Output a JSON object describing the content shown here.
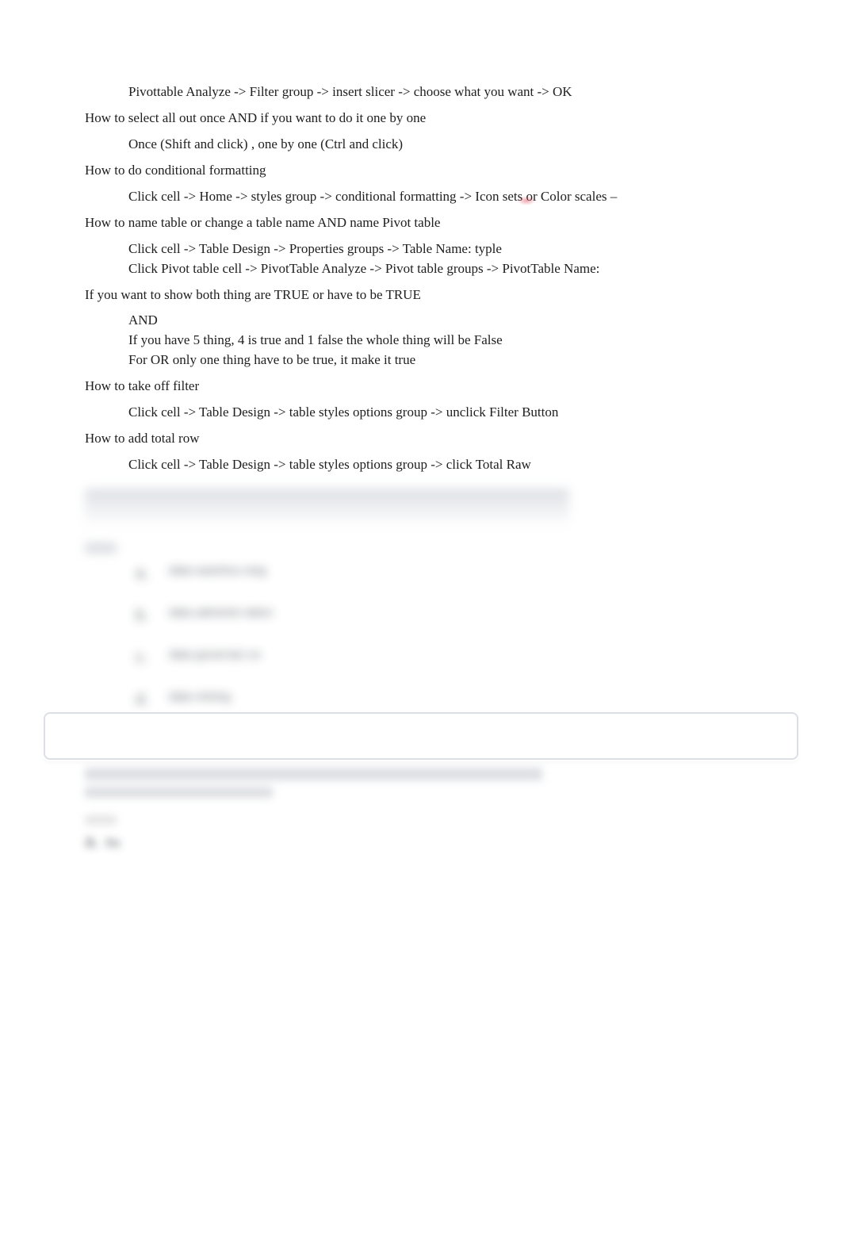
{
  "bullet_glyph": "",
  "sections": [
    {
      "heading": null,
      "items": [
        "Pivottable Analyze -> Filter group -> insert slicer -> choose what you want -> OK"
      ]
    },
    {
      "heading": "How to select all out once AND if you want to do it one by one",
      "items": [
        "Once (Shift and click) , one by one (Ctrl and click)"
      ]
    },
    {
      "heading": "How to do conditional formatting",
      "items": [
        {
          "pre": "Click cell -> Home -> styles group -> conditional formatting -> Icon sets ",
          "hl": " ",
          "post": "or Color scales –"
        }
      ]
    },
    {
      "heading": "How to name table   or change a table name AND  name   Pivot table",
      "items": [
        "Click cell -> Table Design -> Properties groups -> Table Name: typle",
        "Click Pivot table cell -> PivotTable Analyze -> Pivot table groups -> PivotTable Name:"
      ]
    },
    {
      "heading": "If you want to show both thing are TRUE or have to be TRUE",
      "items": [
        "AND",
        "If you have 5 thing, 4 is true and 1 false the whole thing will be False",
        "For OR only one thing have to be true, it make it true"
      ]
    },
    {
      "heading": "How to take off filter",
      "items": [
        "Click cell -> Table Design -> table styles options group -> unclick Filter Button"
      ]
    },
    {
      "heading": "How to add total row",
      "items": [
        "Click cell -> Table Design -> table styles options group -> click Total Raw"
      ]
    }
  ],
  "blurred": {
    "answer_label": "Answers",
    "options": [
      {
        "letter": "a.",
        "text": "data warehou sing"
      },
      {
        "letter": "b.",
        "text": "data administ ration"
      },
      {
        "letter": "c.",
        "text": "data governan ce"
      },
      {
        "letter": "d.",
        "text": "data mining"
      }
    ],
    "q2_answer_letter": "a.",
    "q2_answer_text": "file"
  }
}
